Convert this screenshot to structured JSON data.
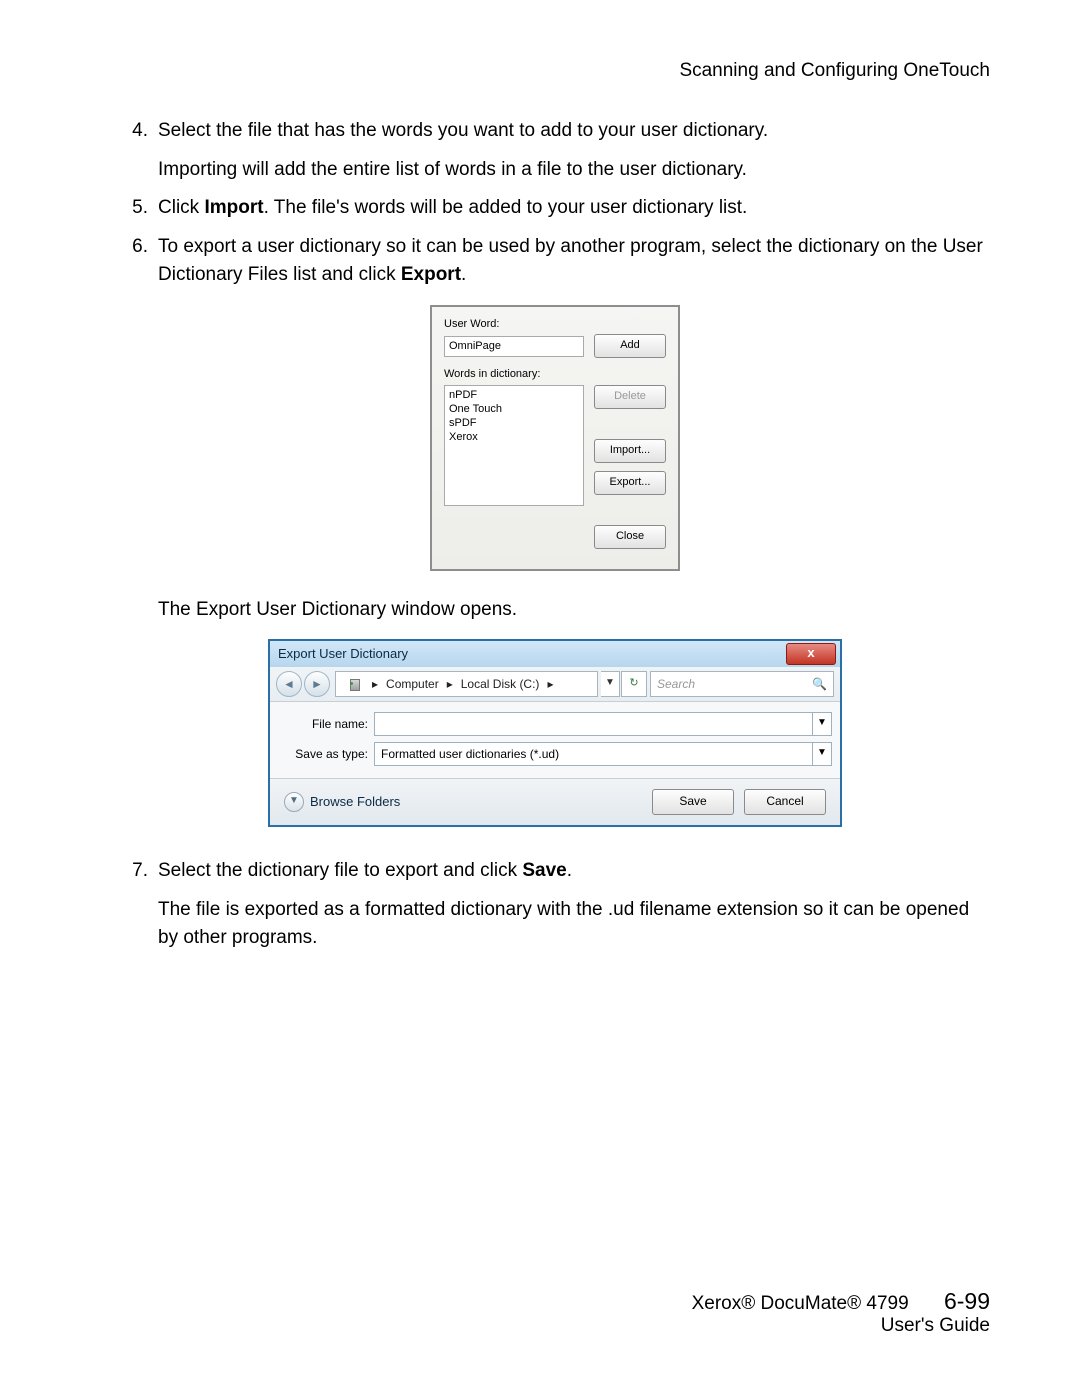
{
  "header": "Scanning and Configuring OneTouch",
  "steps": {
    "s4": {
      "num": "4.",
      "text": "Select the file that has the words you want to add to your user dictionary."
    },
    "s4b": "Importing will add the entire list of words in a file to the user dictionary.",
    "s5": {
      "num": "5.",
      "pre": "Click ",
      "bold": "Import",
      "post": ". The file's words will be added to your user dictionary list."
    },
    "s6": {
      "num": "6.",
      "pre": "To export a user dictionary so it can be used by another program, select the dictionary on the User Dictionary Files list and click ",
      "bold": "Export",
      "post": "."
    },
    "mid": "The Export User Dictionary window opens.",
    "s7": {
      "num": "7.",
      "pre": "Select the dictionary file to export and click ",
      "bold": "Save",
      "post": "."
    },
    "s7b": "The file is exported as a formatted dictionary with the .ud filename extension so it can be opened by other programs."
  },
  "dlg1": {
    "label_user_word": "User Word:",
    "user_word_value": "OmniPage",
    "btn_add": "Add",
    "label_words_in": "Words in dictionary:",
    "list": [
      "nPDF",
      "One Touch",
      "sPDF",
      "Xerox"
    ],
    "btn_delete": "Delete",
    "btn_import": "Import...",
    "btn_export": "Export...",
    "btn_close": "Close"
  },
  "dlg2": {
    "title": "Export User Dictionary",
    "crumb_computer": "Computer",
    "crumb_drive": "Local Disk (C:)",
    "search_placeholder": "Search",
    "lbl_filename": "File name:",
    "val_filename": "",
    "lbl_saveas": "Save as type:",
    "val_saveas": "Formatted user dictionaries (*.ud)",
    "browse": "Browse Folders",
    "btn_save": "Save",
    "btn_cancel": "Cancel"
  },
  "footer": {
    "product": "Xerox® DocuMate® 4799",
    "page": "6-99",
    "sub": "User's Guide"
  }
}
